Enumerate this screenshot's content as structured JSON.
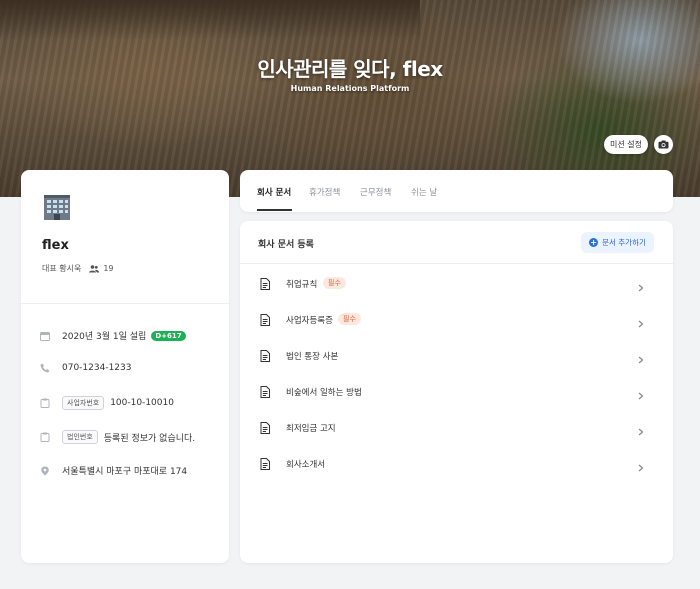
{
  "hero": {
    "title": "인사관리를 잊다, flex",
    "subtitle": "Human Relations Platform",
    "mission_button": "미션 설정",
    "camera_icon": "camera-icon"
  },
  "profile": {
    "company_name": "flex",
    "representative": "대표 황시욱",
    "member_count": "19",
    "founded": "2020년 3월 1일 설립",
    "dday": "D+617",
    "phone": "070-1234-1233",
    "biz_reg_tag": "사업자번호",
    "biz_reg_number": "100-10-10010",
    "corp_tag": "법인번호",
    "corp_value": "등록된 정보가 없습니다.",
    "address": "서울특별시 마포구 마포대로 174"
  },
  "tabs": [
    {
      "label": "회사 문서"
    },
    {
      "label": "휴가정책"
    },
    {
      "label": "근무정책"
    },
    {
      "label": "쉬는 날"
    }
  ],
  "docs": {
    "title": "회사 문서 등록",
    "add_button": "문서 추가하기",
    "required_label": "필수",
    "items": [
      {
        "label": "취업규칙",
        "required": true
      },
      {
        "label": "사업자등록증",
        "required": true
      },
      {
        "label": "법인 통장 사본",
        "required": false
      },
      {
        "label": "비숲에서 일하는 방법",
        "required": false
      },
      {
        "label": "최저임금 고지",
        "required": false
      },
      {
        "label": "회사소개서",
        "required": false
      }
    ]
  },
  "colors": {
    "accent": "#2d6fd6",
    "dday": "#1db057",
    "required_text": "#e0653a",
    "required_bg": "#fde8df"
  }
}
